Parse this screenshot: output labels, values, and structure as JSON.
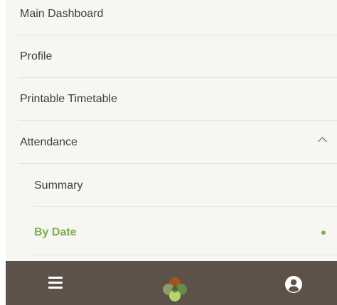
{
  "menu": {
    "items": [
      {
        "label": "Main Dashboard"
      },
      {
        "label": "Profile"
      },
      {
        "label": "Printable Timetable"
      },
      {
        "label": "Attendance",
        "expanded": true,
        "icon": "chevron-up-icon"
      }
    ],
    "subitems": [
      {
        "label": "Summary"
      },
      {
        "label": "By Date",
        "active": true
      }
    ]
  },
  "bottom_bar": {
    "menu_icon": "hamburger-icon",
    "logo_icon": "four-leaf-logo-icon",
    "account_icon": "account-circle-icon"
  },
  "colors": {
    "active": "#7ab04a",
    "bottom_bar": "#5d524a",
    "menu_bg": "#f7f6f3",
    "text": "#3d3d3d"
  }
}
